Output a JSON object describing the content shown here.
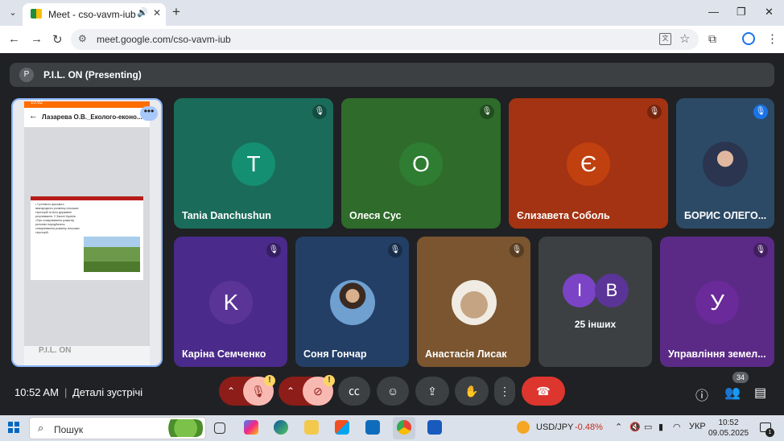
{
  "browser": {
    "tab_title": "Meet - cso-vavm-iub",
    "url": "meet.google.com/cso-vavm-iub",
    "new_tab_glyph": "+",
    "window_controls": [
      "—",
      "❐",
      "✕"
    ]
  },
  "meet": {
    "presenting_avatar": "P",
    "presenting_text": "P.I.L. ON (Presenting)",
    "presentation": {
      "status_time": "10:52",
      "doc_title": "Лазарева О.В._Еколого-еконо...",
      "slide_text": "• Суттєвість фахового міжнародного розвитку сільських територій та його державне регулювання. У Законі України «Про стимулювання розвитку регіонів» передбачено стимулювання розвитку сільських територій.",
      "watermark": "P.I.L. ON",
      "more_glyph": "•••"
    },
    "participants": [
      {
        "name": "Tania Danchushun",
        "initial": "T",
        "color": "#1b6b5a"
      },
      {
        "name": "Олеся Сус",
        "initial": "О",
        "color": "#2f6b2b"
      },
      {
        "name": "Єлизавета Соболь",
        "initial": "Є",
        "color": "#a33312"
      },
      {
        "name": "БОРИС ОЛЕГО...",
        "initial": "",
        "color": "#2c4a66"
      },
      {
        "name": "Каріна Семченко",
        "initial": "K",
        "color": "#4a2a8a"
      },
      {
        "name": "Соня Гончар",
        "initial": "",
        "color": "#233f66"
      },
      {
        "name": "Анастасія Лисак",
        "initial": "",
        "color": "#7a5530"
      },
      {
        "name": "Управління земел...",
        "initial": "У",
        "color": "#5b2a86"
      }
    ],
    "others": {
      "initials": [
        "I",
        "B"
      ],
      "label": "25 інших"
    },
    "controls": {
      "time": "10:52 AM",
      "separator": "|",
      "details": "Деталі зустрічі",
      "participant_count": "34",
      "warn_glyph": "!"
    }
  },
  "taskbar": {
    "search_placeholder": "Пошук",
    "ticker_name": "USD/JPY",
    "ticker_change": "-0.48%",
    "language": "УКР",
    "clock_time": "10:52",
    "clock_date": "09.05.2025",
    "notification_count": "1"
  }
}
